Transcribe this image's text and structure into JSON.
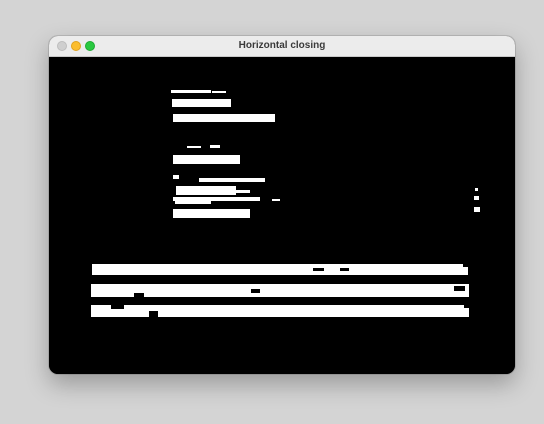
{
  "window": {
    "title": "Horizontal closing"
  },
  "titlebar_buttons": [
    {
      "name": "close",
      "color": "#cfcfcf"
    },
    {
      "name": "minimize",
      "color": "#fbbd2e"
    },
    {
      "name": "maximize",
      "color": "#29c940"
    }
  ],
  "image": {
    "description_type": "binary morphological result",
    "background_color": "#000000",
    "foreground_color": "#ffffff"
  }
}
